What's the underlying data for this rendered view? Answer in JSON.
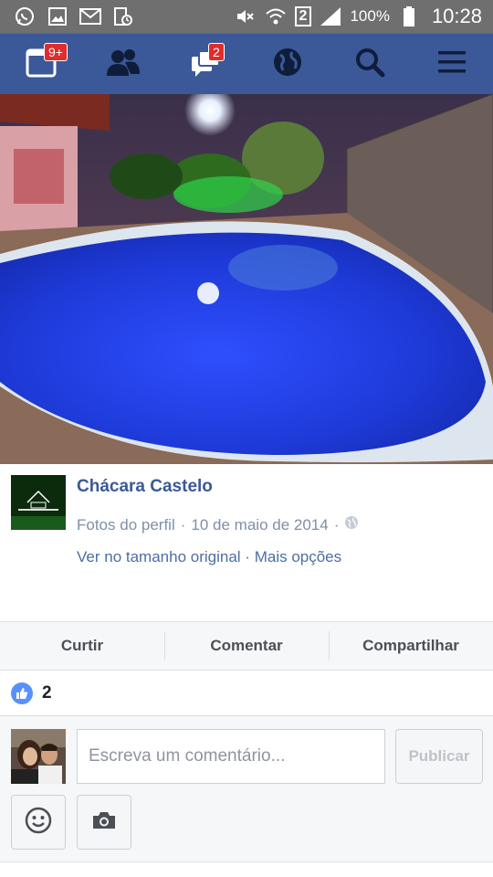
{
  "status_bar": {
    "battery_percent": "100%",
    "time": "10:28",
    "sim_label": "2",
    "icons": [
      "whatsapp-icon",
      "gallery-icon",
      "email-icon",
      "clock-icon",
      "mute-icon",
      "wifi-icon",
      "signal-icon",
      "battery-icon"
    ]
  },
  "nav": {
    "notifications_badge": "9+",
    "messages_badge": "2",
    "icons": [
      "notifications-icon",
      "friends-icon",
      "messages-icon",
      "globe-icon",
      "search-icon",
      "menu-icon"
    ],
    "bg_color": "#3b5998"
  },
  "post": {
    "page_name": "Chácara Castelo",
    "album": "Fotos do perfil",
    "separator": "·",
    "date": "10 de maio de 2014",
    "dot": "·",
    "link_original": "Ver no tamanho original",
    "link_sep": "·",
    "link_more": "Mais opções"
  },
  "actions": {
    "like": "Curtir",
    "comment": "Comentar",
    "share": "Compartilhar"
  },
  "likes": {
    "count": "2"
  },
  "composer": {
    "placeholder": "Escreva um comentário...",
    "publish_label": "Publicar"
  }
}
